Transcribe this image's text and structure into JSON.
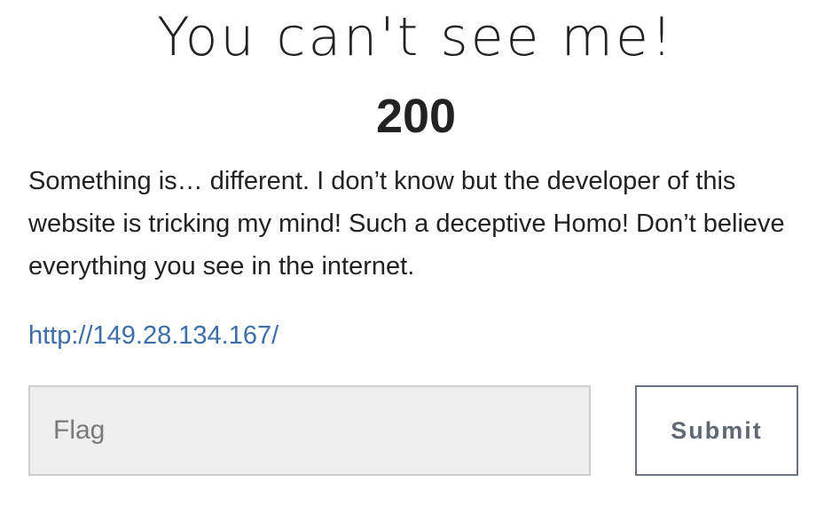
{
  "challenge": {
    "title": "You can't see me!",
    "points": "200",
    "description": "Something is… different. I don’t know but the developer of this website is tricking my mind! Such a deceptive Homo! Don’t believe everything you see in the internet.",
    "link_text": "http://149.28.134.167/",
    "flag_input": {
      "placeholder": "Flag",
      "value": ""
    },
    "submit_label": "Submit"
  },
  "colors": {
    "text": "#222222",
    "link": "#3d6ea8",
    "input_background": "#eeeeee",
    "button_text": "#5f6873"
  }
}
